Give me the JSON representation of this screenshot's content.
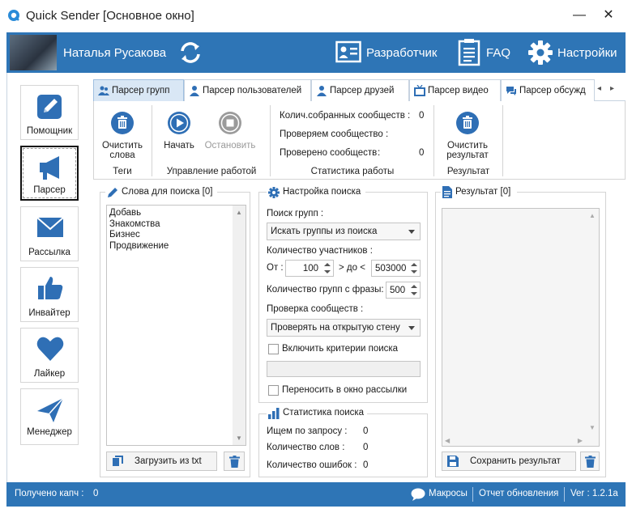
{
  "window": {
    "title": "Quick Sender [Основное окно]",
    "minimize": "—",
    "close": "✕"
  },
  "header": {
    "user_name": "Наталья Русакова",
    "developer": "Разработчик",
    "faq": "FAQ",
    "settings": "Настройки"
  },
  "sidebar": {
    "items": [
      {
        "label": "Помощник"
      },
      {
        "label": "Парсер"
      },
      {
        "label": "Рассылка"
      },
      {
        "label": "Инвайтер"
      },
      {
        "label": "Лайкер"
      },
      {
        "label": "Менеджер"
      }
    ],
    "active": "Парсер"
  },
  "tabs": [
    {
      "label": "Парсер групп"
    },
    {
      "label": "Парсер пользователей"
    },
    {
      "label": "Парсер друзей"
    },
    {
      "label": "Парсер видео"
    },
    {
      "label": "Парсер обсужд"
    }
  ],
  "ribbon": {
    "tags": {
      "clear_line1": "Очистить",
      "clear_line2": "слова",
      "group": "Теги"
    },
    "control": {
      "start": "Начать",
      "stop": "Остановить",
      "group": "Управление работой"
    },
    "stats": {
      "collected_label": "Колич.собранных сообществ :",
      "collected_value": "0",
      "checking_label": "Проверяем сообщество :",
      "checking_value": "",
      "checked_label": "Проверено сообществ",
      "checked_colon": ":",
      "checked_value": "0",
      "group": "Статистика работы"
    },
    "result": {
      "clear_line1": "Очистить",
      "clear_line2": "результат",
      "group": "Результат"
    }
  },
  "words": {
    "title": "Слова для поиска [0]",
    "items": [
      "Добавь",
      "Знакомства",
      "Бизнес",
      "Продвижение"
    ],
    "load_button": "Загрузить из txt"
  },
  "settings": {
    "title": "Настройка поиска",
    "search_groups_label": "Поиск групп :",
    "search_groups_value": "Искать группы из поиска",
    "members_label": "Количество участников :",
    "from_label": "От :",
    "from_value": "100",
    "to_label": "> до <",
    "to_value": "503000",
    "per_phrase_label": "Количество групп с фразы:",
    "per_phrase_value": "500",
    "check_label": "Проверка сообществ :",
    "check_value": "Проверять на открытую стену",
    "criteria_label": "Включить критерии поиска",
    "criteria_value": "",
    "transfer_label": "Переносить в окно рассылки"
  },
  "search_stats": {
    "title": "Статистика поиска",
    "query_label": "Ищем по запросу :",
    "query_value": "0",
    "words_label": "Количество слов :",
    "words_value": "0",
    "errors_label": "Количество ошибок :",
    "errors_value": "0"
  },
  "result": {
    "title": "Результат [0]",
    "save_button": "Сохранить результат"
  },
  "statusbar": {
    "captcha_label": "Получено капч :",
    "captcha_value": "0",
    "macros": "Макросы",
    "update_report": "Отчет обновления",
    "version": "Ver : 1.2.1a"
  },
  "colors": {
    "accent": "#2e75b6",
    "icon_blue": "#2f6fb5",
    "icon_gray": "#9b9b9b"
  }
}
